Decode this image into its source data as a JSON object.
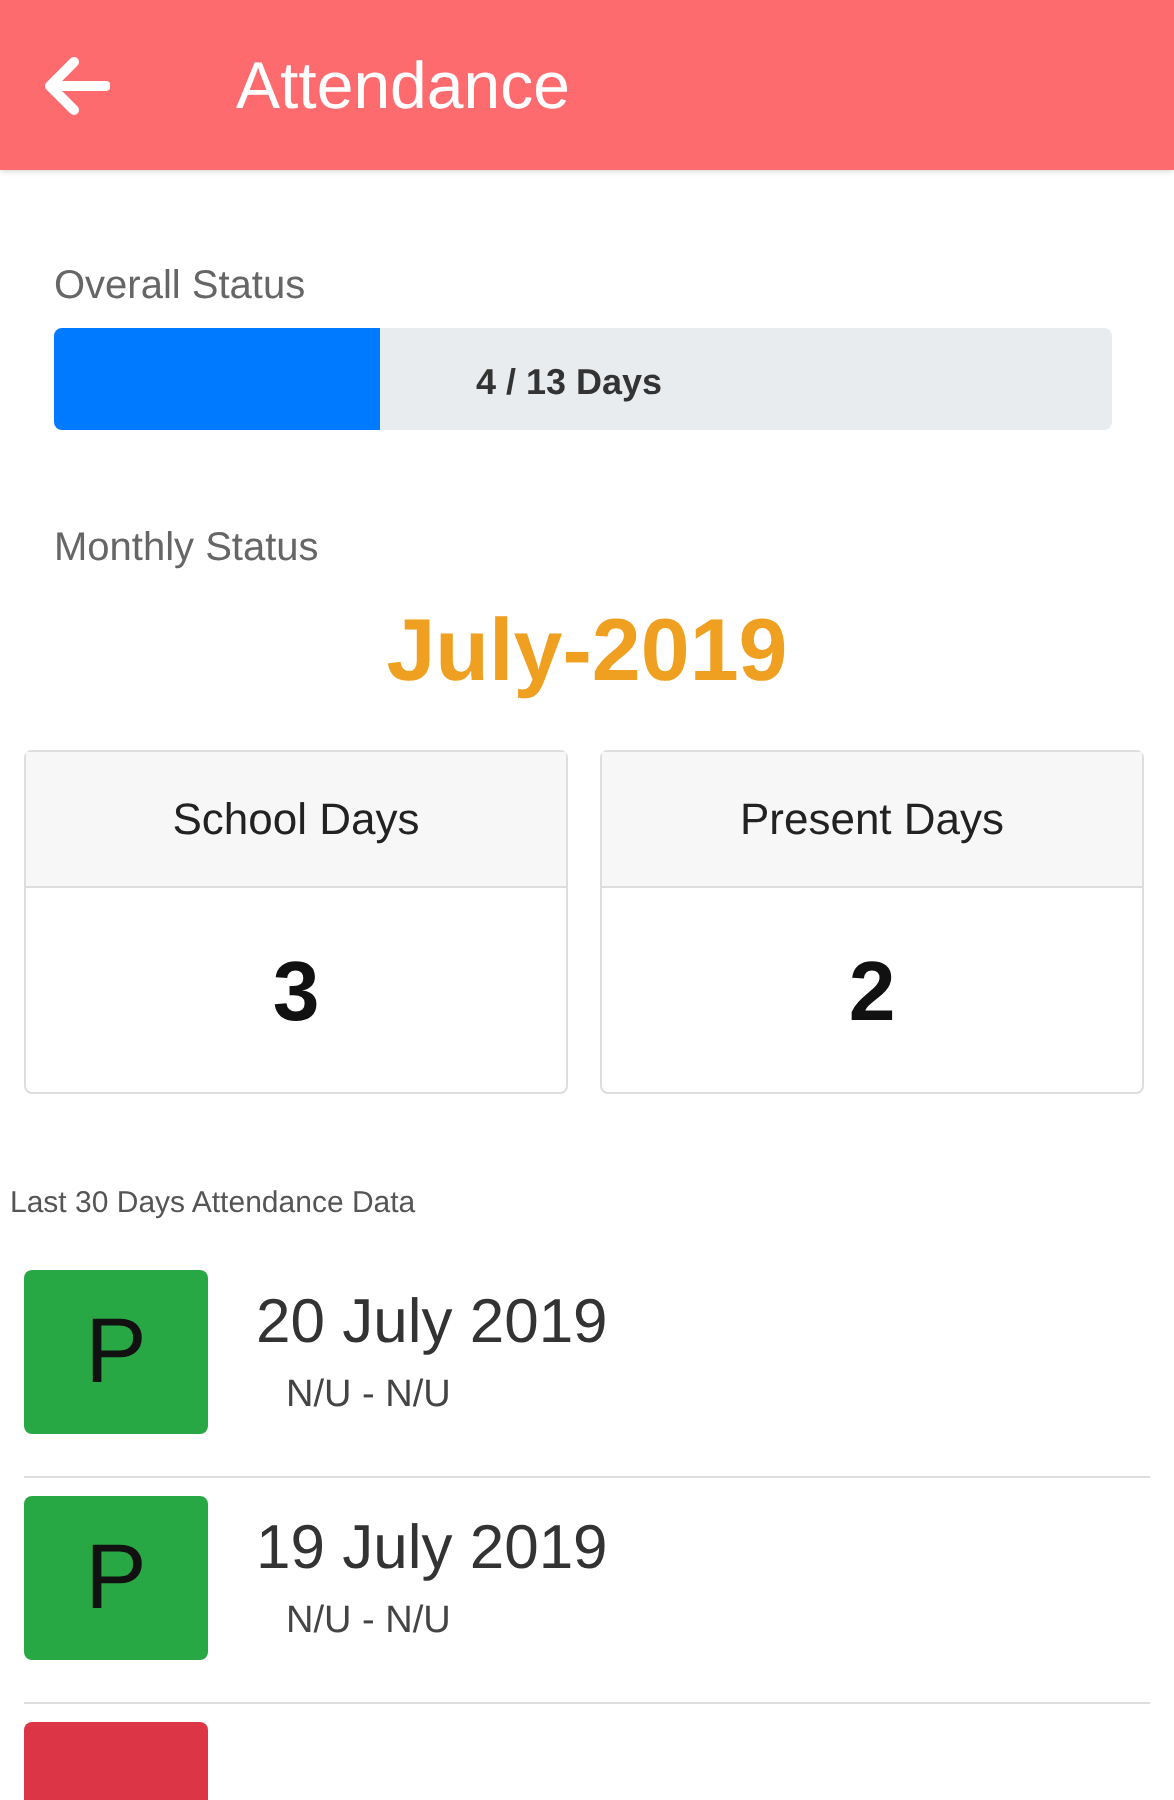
{
  "header": {
    "title": "Attendance"
  },
  "overall": {
    "label": "Overall Status",
    "level": 0.308,
    "reading": "4 / 13 Days"
  },
  "monthly": {
    "label": "Monthly Status",
    "month": "July-2019",
    "cards": [
      {
        "title": "School Days",
        "value": "3"
      },
      {
        "title": "Present Days",
        "value": "2"
      }
    ]
  },
  "history": {
    "label": "Last 30 Days Attendance Data",
    "rows": [
      {
        "mark": "P",
        "color": "#28a745",
        "date": "20 July 2019",
        "detail": "N/U - N/U"
      },
      {
        "mark": "P",
        "color": "#28a745",
        "date": "19 July 2019",
        "detail": "N/U - N/U"
      },
      {
        "color": "#dc3545"
      }
    ]
  }
}
